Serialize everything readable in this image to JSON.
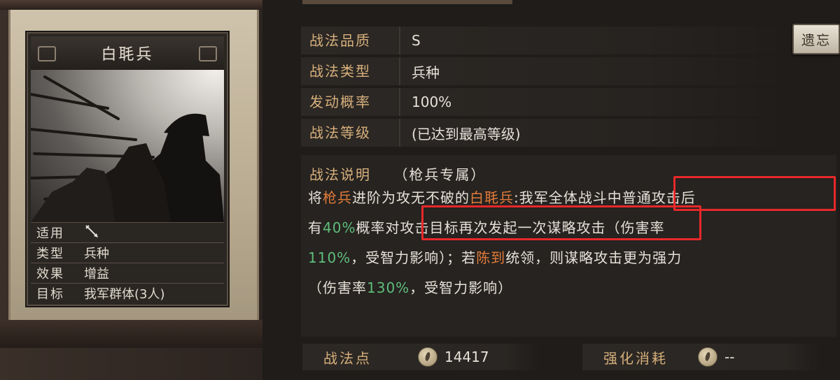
{
  "card": {
    "name": "白毦兵",
    "fields": [
      {
        "key": "适用",
        "value": ""
      },
      {
        "key": "类型",
        "value": "兵种"
      },
      {
        "key": "效果",
        "value": "增益"
      },
      {
        "key": "目标",
        "value": "我军群体(3人)"
      }
    ],
    "applies_icon": "spear-icon"
  },
  "stats": [
    {
      "label": "战法品质",
      "value": "S"
    },
    {
      "label": "战法类型",
      "value": "兵种"
    },
    {
      "label": "发动概率",
      "value": "100%"
    },
    {
      "label": "战法等级",
      "value": "(已达到最高等级)"
    }
  ],
  "forget_button": "遗忘",
  "description": {
    "label": "战法说明",
    "tag": "（枪兵专属）",
    "p1": "将",
    "p2": "枪兵",
    "p3": "进阶为攻无不破的",
    "p4": "白毦兵",
    "p5": ":我军全体战斗中普通攻击后",
    "p6": "有",
    "p7": "40%",
    "p8": "概率对攻击目标再次发起一次谋略攻击（伤害率",
    "p9": "110%",
    "p10": "，受智力影响）；若",
    "p11": "陈到",
    "p12": "统领，则谋略攻击更为强力",
    "p13": "（伤害率",
    "p14": "130%",
    "p15": "，受智力影响）"
  },
  "tactic_points": {
    "label": "战法点",
    "value": "14417",
    "icon": "coin-icon"
  },
  "upgrade_cost": {
    "label": "强化消耗",
    "value": "--",
    "icon": "coin-icon"
  },
  "colors": {
    "label_gold": "#d7b07c",
    "highlight_orange": "#e27b3a",
    "highlight_green": "#5fbd7a",
    "annotation_red": "#e8282a"
  }
}
